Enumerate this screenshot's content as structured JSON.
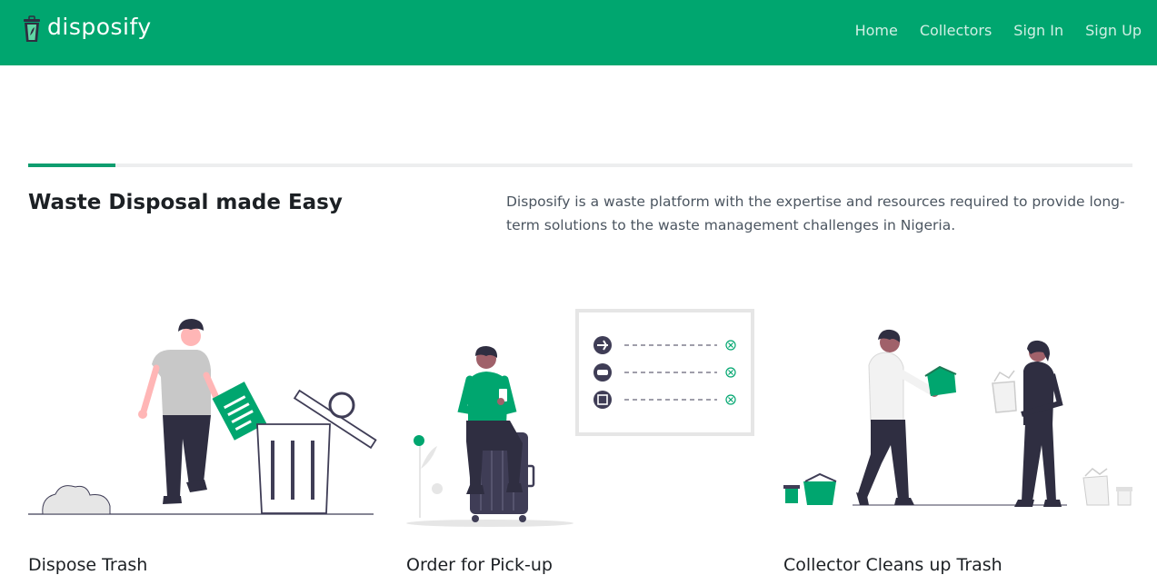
{
  "brand": {
    "name": "disposify"
  },
  "nav": {
    "items": [
      {
        "label": "Home"
      },
      {
        "label": "Collectors"
      },
      {
        "label": "Sign In"
      },
      {
        "label": "Sign Up"
      }
    ]
  },
  "hero": {
    "title": "Waste Disposal made Easy",
    "description": "Disposify is a waste platform with the expertise and resources required to provide long-term solutions to the waste management challenges in Nigeria."
  },
  "steps": [
    {
      "title": "Dispose Trash",
      "illustration": "person-throwing-trash-illustration"
    },
    {
      "title": "Order for Pick-up",
      "illustration": "person-on-luggage-with-phone-illustration"
    },
    {
      "title": "Collector Cleans up Trash",
      "illustration": "collector-receiving-box-illustration"
    }
  ],
  "colors": {
    "brand_green": "#00a66f",
    "dark": "#2f2e41",
    "skin": "#ffb6b6",
    "skin_dark": "#a0616a"
  }
}
